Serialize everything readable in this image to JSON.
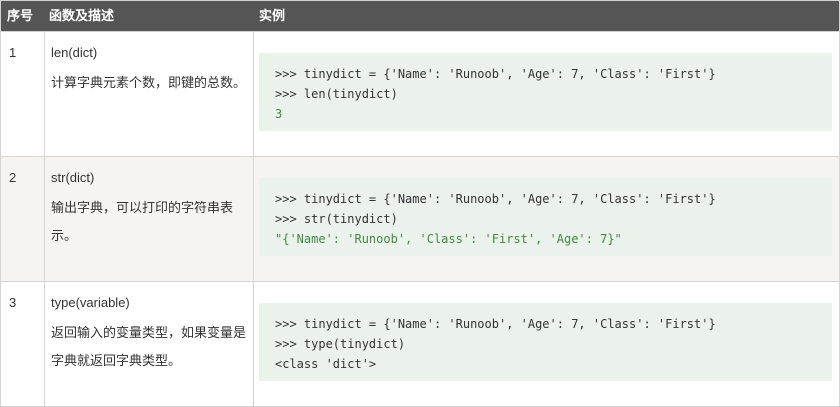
{
  "header": {
    "index_label": "序号",
    "function_label": "函数及描述",
    "example_label": "实例"
  },
  "rows": [
    {
      "index": "1",
      "function": "len(dict)",
      "description": "计算字典元素个数，即键的总数。",
      "code_line1": ">>> tinydict = {'Name': 'Runoob', 'Age': 7, 'Class': 'First'}",
      "code_line2": ">>> len(tinydict)",
      "code_output": "3"
    },
    {
      "index": "2",
      "function": "str(dict)",
      "description": "输出字典，可以打印的字符串表示。",
      "code_line1": ">>> tinydict = {'Name': 'Runoob', 'Age': 7, 'Class': 'First'}",
      "code_line2": ">>> str(tinydict)",
      "code_output": "\"{'Name': 'Runoob', 'Class': 'First', 'Age': 7}\""
    },
    {
      "index": "3",
      "function": "type(variable)",
      "description": "返回输入的变量类型，如果变量是字典就返回字典类型。",
      "code_line1": ">>> tinydict = {'Name': 'Runoob', 'Age': 7, 'Class': 'First'}",
      "code_line2": ">>> type(tinydict)",
      "code_output": "<class 'dict'>"
    }
  ],
  "colors": {
    "header_bg": "#555555",
    "alt_row_bg": "#f6f4f0",
    "code_bg": "#eaf2eb",
    "code_string": "#448844"
  }
}
